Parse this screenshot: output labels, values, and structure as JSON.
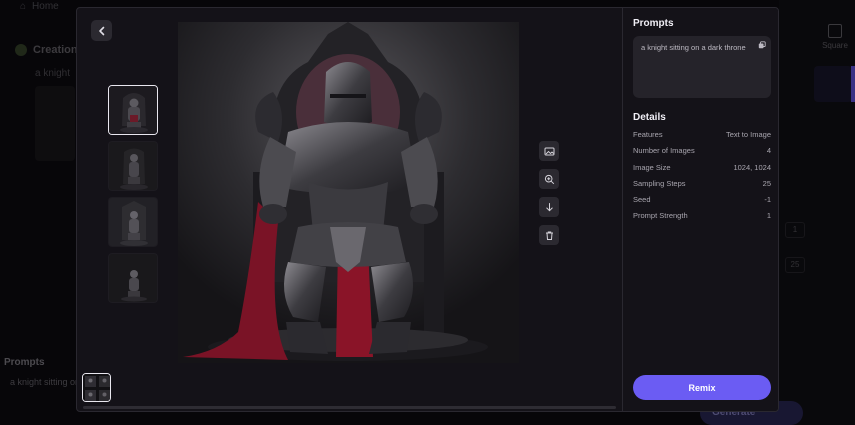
{
  "background": {
    "home_label": "Home",
    "creation_label": "Creation",
    "prompt_line": "a knight",
    "prompts_label": "Prompts",
    "prompts_text": "a knight sitting on",
    "square_label": "Square",
    "generate_label": "Generate",
    "field_values": [
      "1",
      "25"
    ]
  },
  "modal": {
    "back_icon": "chevron-left-icon",
    "tools": [
      {
        "name": "set-image-icon"
      },
      {
        "name": "zoom-in-icon"
      },
      {
        "name": "download-icon"
      },
      {
        "name": "delete-icon"
      }
    ]
  },
  "panel": {
    "prompts_title": "Prompts",
    "prompt_text": "a knight sitting on a dark throne",
    "details_title": "Details",
    "details": [
      {
        "label": "Features",
        "value": "Text to Image"
      },
      {
        "label": "Number of Images",
        "value": "4"
      },
      {
        "label": "Image Size",
        "value": "1024, 1024"
      },
      {
        "label": "Sampling Steps",
        "value": "25"
      },
      {
        "label": "Seed",
        "value": "-1"
      },
      {
        "label": "Prompt Strength",
        "value": "1"
      }
    ],
    "remix_label": "Remix"
  },
  "colors": {
    "accent": "#6b5cf3",
    "panel_bg": "#141218",
    "box_bg": "#25232a"
  }
}
